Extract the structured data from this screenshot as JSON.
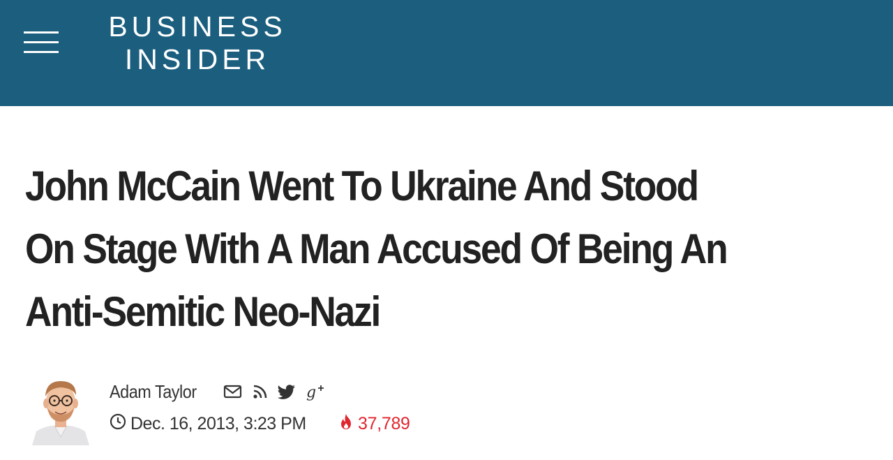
{
  "header": {
    "logo_line1": "BUSINESS",
    "logo_line2": "INSIDER",
    "background_color": "#1b5e7e",
    "menu_icon": "hamburger-menu-icon"
  },
  "article": {
    "headline_line1": "John McCain Went To Ukraine And Stood",
    "headline_line2": "On Stage With A Man Accused Of Being An",
    "headline_line3": "Anti-Semitic Neo-Nazi",
    "author": "Adam Taylor",
    "share_icons": [
      "email-icon",
      "rss-icon",
      "twitter-icon",
      "google-plus-icon"
    ],
    "date": "Dec. 16, 2013, 3:23 PM",
    "views": "37,789",
    "views_color": "#e0262f"
  }
}
